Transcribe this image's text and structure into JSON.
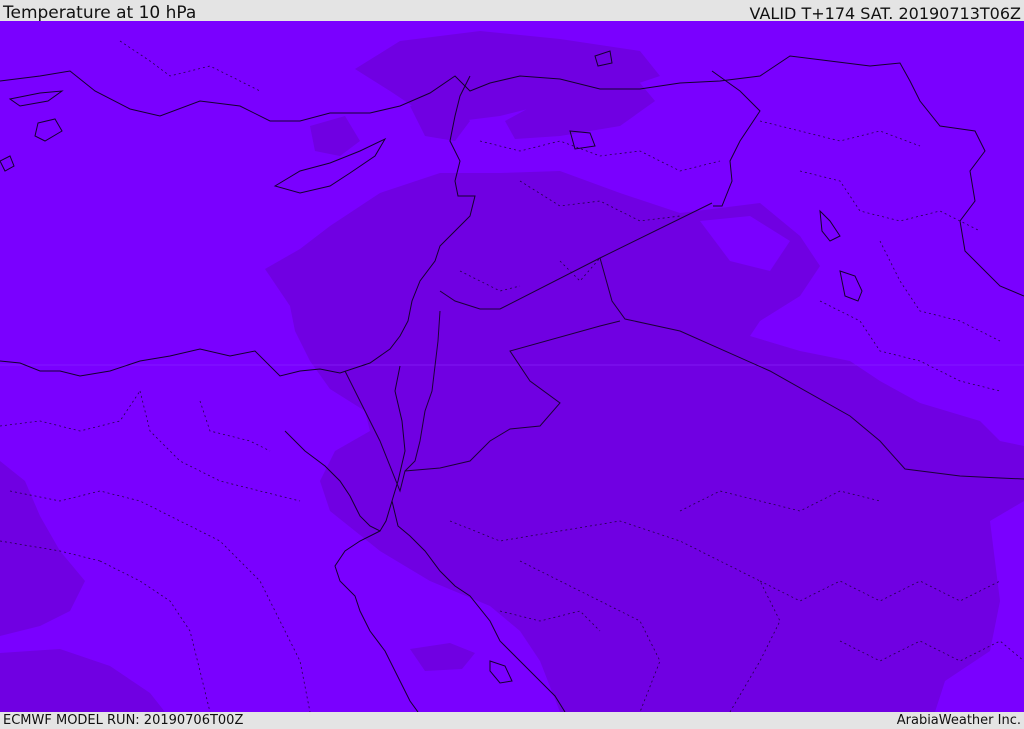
{
  "header": {
    "title": "Temperature at 10 hPa",
    "valid": "VALID T+174 SAT. 20190713T06Z"
  },
  "footer": {
    "model_run": "ECMWF MODEL RUN: 20190706T00Z",
    "credit": "ArabiaWeather Inc."
  },
  "map": {
    "field_colors": {
      "light": "#7a00ff",
      "dark": "#7000e2"
    },
    "line_colors": {
      "coast": "#15002e",
      "border": "#1c0038"
    }
  }
}
